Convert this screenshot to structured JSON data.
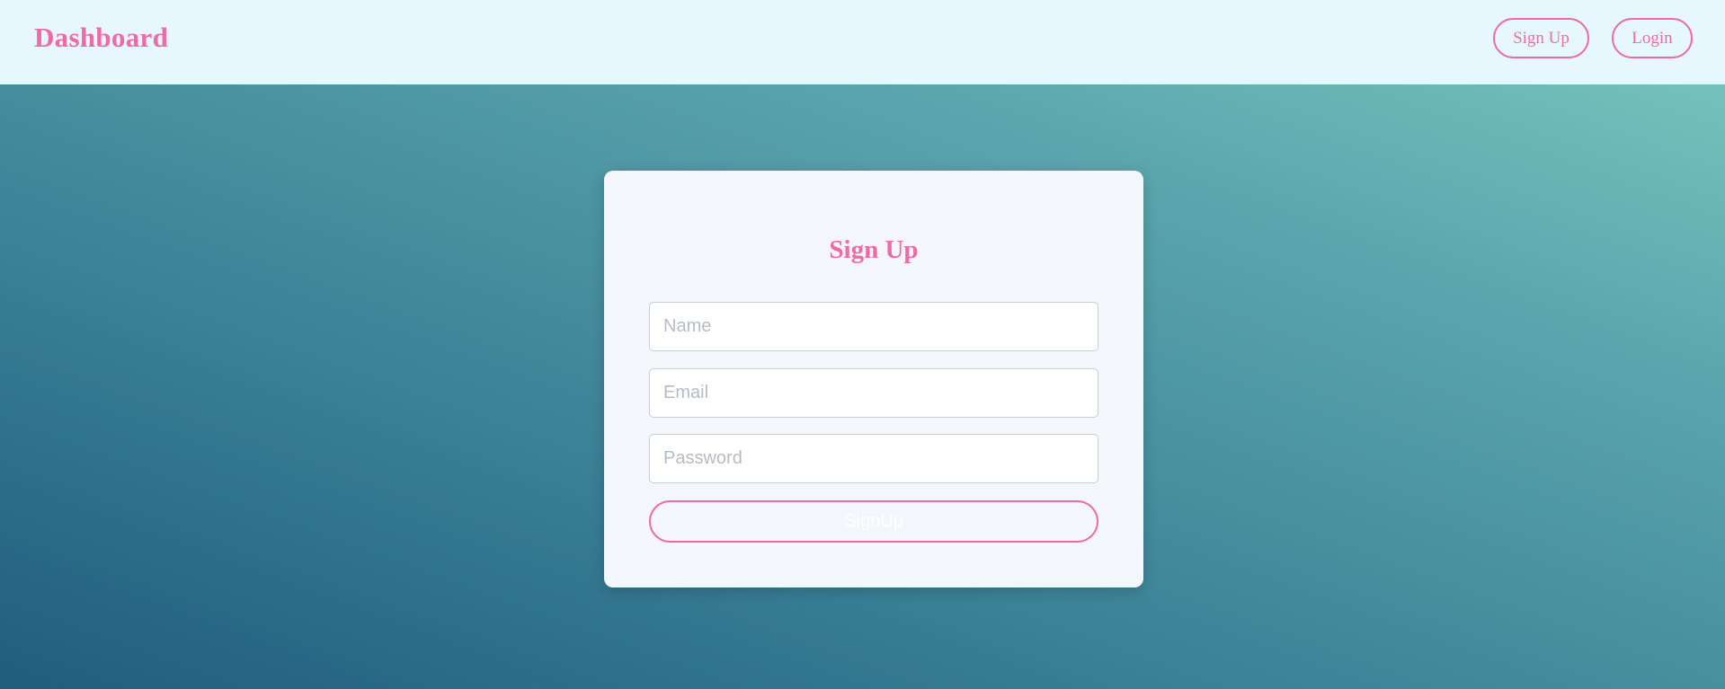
{
  "header": {
    "brand": "Dashboard",
    "signup_label": "Sign Up",
    "login_label": "Login"
  },
  "form": {
    "title": "Sign Up",
    "name": {
      "placeholder": "Name",
      "value": ""
    },
    "email": {
      "placeholder": "Email",
      "value": ""
    },
    "password": {
      "placeholder": "Password",
      "value": ""
    },
    "submit_label": "SignUp"
  },
  "colors": {
    "accent": "#ef6aa8",
    "header_bg": "#e6f8fe",
    "card_bg": "#f3f6fb",
    "gradient_light": "#7cc9c0",
    "gradient_dark": "#1f5d7e"
  }
}
